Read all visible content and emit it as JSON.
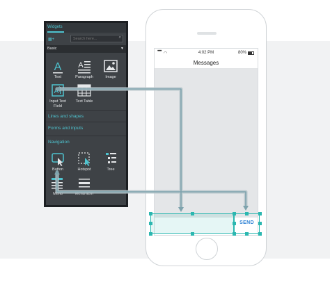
{
  "panel": {
    "tab_label": "Widgets",
    "search_placeholder": "Search here...",
    "library_label": "Basic",
    "widgets": [
      {
        "label": "Text"
      },
      {
        "label": "Paragraph"
      },
      {
        "label": "Image"
      },
      {
        "label": "Input Text Field"
      },
      {
        "label": "Text Table"
      },
      {
        "label": "Button"
      },
      {
        "label": "Hotspot"
      },
      {
        "label": "Tree"
      },
      {
        "label": "Menu"
      },
      {
        "label": "Menu Item"
      }
    ],
    "sections": [
      {
        "label": "Lines and shapes"
      },
      {
        "label": "Forms and inputs"
      },
      {
        "label": "Navigation"
      }
    ]
  },
  "phone": {
    "status_time": "4:02 PM",
    "status_battery": "80%",
    "nav_title": "Messages",
    "send_label": "SEND"
  },
  "colors": {
    "accent": "#2bb7b0",
    "panel_bg": "#3e4246",
    "link_blue": "#2a7fd4"
  }
}
